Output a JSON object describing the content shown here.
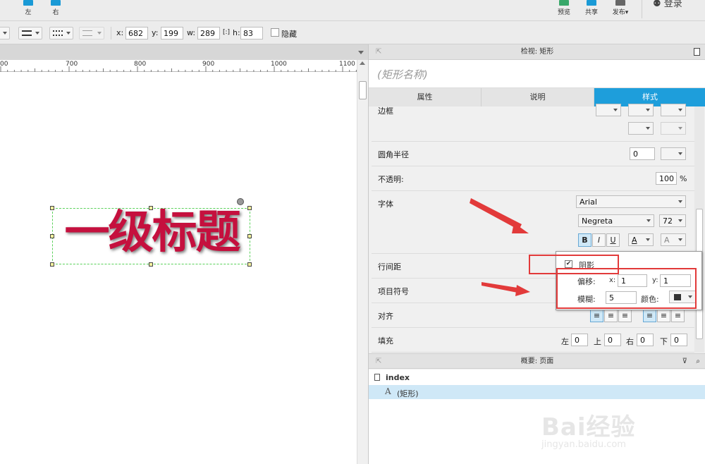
{
  "toolbar": {
    "align_left_label": "左",
    "align_right_label": "右",
    "preview_label": "预览",
    "share_label": "共享",
    "publish_label": "发布",
    "login_label": "登录"
  },
  "geometry": {
    "x_label": "x:",
    "x_value": "682",
    "y_label": "y:",
    "y_value": "199",
    "w_label": "w:",
    "w_value": "289",
    "h_label": "h:",
    "h_value": "83",
    "hide_label": "隐藏"
  },
  "ruler": {
    "labels": [
      "00",
      "700",
      "800",
      "900",
      "1000",
      "1100"
    ]
  },
  "canvas": {
    "text": "一级标题",
    "text_color": "#c5103e"
  },
  "inspector": {
    "title": "检视: 矩形",
    "name_placeholder": "(矩形名称)",
    "tabs": [
      "属性",
      "说明",
      "样式"
    ],
    "border_label": "边框",
    "radius_label": "圆角半径",
    "radius_value": "0",
    "opacity_label": "不透明:",
    "opacity_value": "100",
    "opacity_unit": "%",
    "font_label": "字体",
    "font_family": "Arial",
    "font_style": "Negreta",
    "font_size": "72",
    "bold": "B",
    "italic": "I",
    "underline": "U",
    "font_color_btn": "A",
    "text_shadow_btn": "A",
    "line_spacing_label": "行间距",
    "bullets_label": "项目符号",
    "align_label": "对齐",
    "padding_label": "填充",
    "padding_left_label": "左",
    "padding_left": "0",
    "padding_top_label": "上",
    "padding_top": "0",
    "padding_right_label": "右",
    "padding_right": "0",
    "padding_bottom_label": "下",
    "padding_bottom": "0"
  },
  "shadow_popup": {
    "shadow_label": "阴影",
    "offset_label": "偏移:",
    "offset_x_label": "x:",
    "offset_x": "1",
    "offset_y_label": "y:",
    "offset_y": "1",
    "blur_label": "模糊:",
    "blur": "5",
    "color_label": "颜色:"
  },
  "outline": {
    "title": "概要: 页面",
    "page_name": "index",
    "item_label": "(矩形)"
  },
  "watermark": {
    "text": "Bai经验",
    "url": "jingyan.baidu.com"
  },
  "colors": {
    "accent_tab": "#1e9edb",
    "highlight_red": "#e23a3a",
    "selection_bg": "#cfe8f7"
  }
}
